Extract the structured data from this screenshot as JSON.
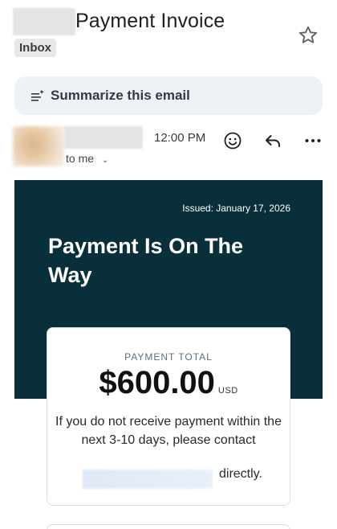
{
  "header": {
    "subject": "Payment Invoice",
    "label_chip": "Inbox",
    "star_icon": "star-outline-icon"
  },
  "summarize": {
    "label": "Summarize this email",
    "icon": "sparkle-list-icon"
  },
  "message": {
    "time": "12:00 PM",
    "recipient": "to me",
    "actions": [
      "emoji-icon",
      "reply-icon",
      "more-vert-icon"
    ]
  },
  "email_body": {
    "issued": "Issued: January 17, 2026",
    "headline": "Payment Is On The Way",
    "payment_label": "PAYMENT TOTAL",
    "amount": "$600.00",
    "currency": "USD",
    "note": "If you do not receive payment within the next 3-10 days, please contact",
    "note_end": "directly."
  },
  "colors": {
    "hero_bg": "#09303a",
    "summarize_bg": "#eef1f6"
  }
}
